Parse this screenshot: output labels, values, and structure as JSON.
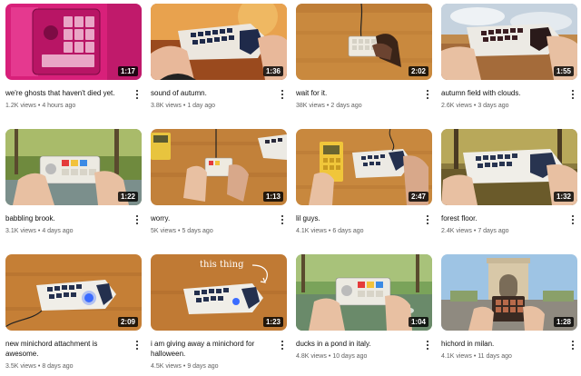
{
  "videos": [
    {
      "title": "we're ghosts that haven't died yet.",
      "views": "1.2K views",
      "age": "4 hours ago",
      "duration": "1:17"
    },
    {
      "title": "sound of autumn.",
      "views": "3.8K views",
      "age": "1 day ago",
      "duration": "1:36"
    },
    {
      "title": "wait for it.",
      "views": "38K views",
      "age": "2 days ago",
      "duration": "2:02"
    },
    {
      "title": "autumn field with clouds.",
      "views": "2.6K views",
      "age": "3 days ago",
      "duration": "1:55"
    },
    {
      "title": "babbling brook.",
      "views": "3.1K views",
      "age": "4 days ago",
      "duration": "1:22"
    },
    {
      "title": "worry.",
      "views": "5K views",
      "age": "5 days ago",
      "duration": "1:13"
    },
    {
      "title": "lil guys.",
      "views": "4.1K views",
      "age": "6 days ago",
      "duration": "2:47"
    },
    {
      "title": "forest floor.",
      "views": "2.4K views",
      "age": "7 days ago",
      "duration": "1:32"
    },
    {
      "title": "new minichord attachment is awesome.",
      "views": "3.5K views",
      "age": "8 days ago",
      "duration": "2:09"
    },
    {
      "title": "i am giving away a minichord for halloween.",
      "views": "4.5K views",
      "age": "9 days ago",
      "duration": "1:23",
      "overlay_text": "this thing"
    },
    {
      "title": "ducks in a pond in italy.",
      "views": "4.8K views",
      "age": "10 days ago",
      "duration": "1:04"
    },
    {
      "title": "hichord in milan.",
      "views": "4.1K views",
      "age": "11 days ago",
      "duration": "1:28"
    }
  ],
  "separator": "•",
  "icons": {
    "more": "more-vert-icon"
  }
}
